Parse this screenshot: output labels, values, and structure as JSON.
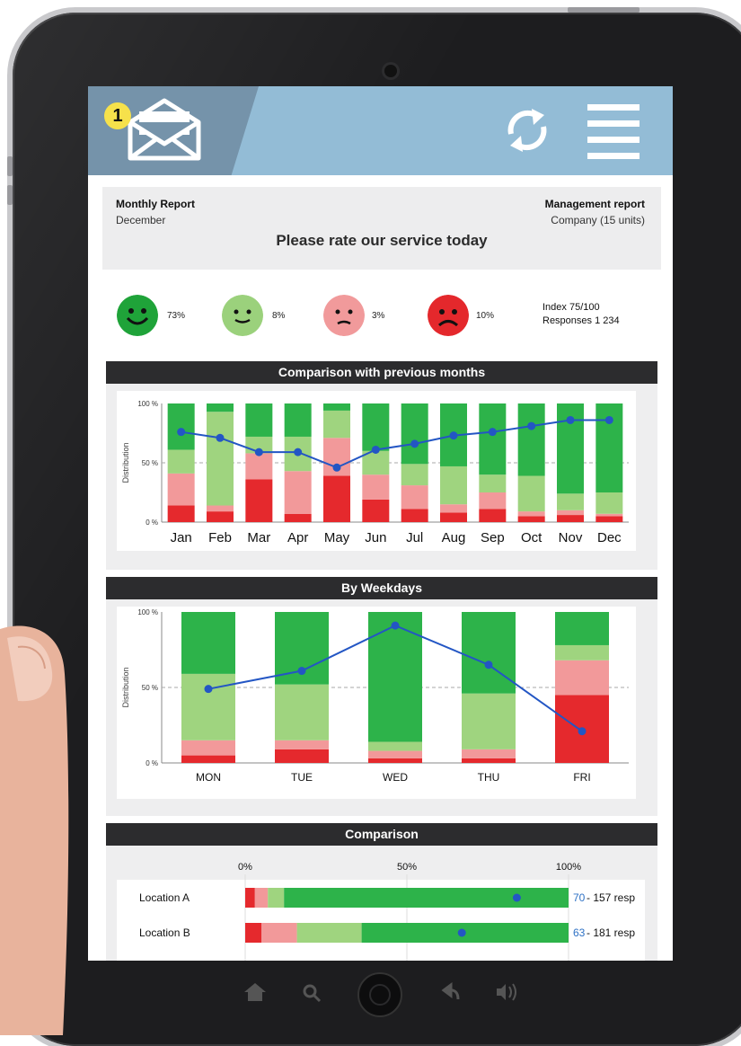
{
  "header": {
    "badge_count": "1",
    "icons": [
      "mail-icon",
      "sync-icon",
      "menu-icon"
    ]
  },
  "report": {
    "left_title": "Monthly Report",
    "left_sub": "December",
    "right_title": "Management report",
    "right_sub": "Company (15 units)",
    "prompt": "Please rate our service today"
  },
  "ratings": [
    {
      "name": "very-satisfied",
      "pct": "73%",
      "color": "#1fa339"
    },
    {
      "name": "satisfied",
      "pct": "8%",
      "color": "#9bd17c"
    },
    {
      "name": "dissatisfied",
      "pct": "3%",
      "color": "#f19a9b"
    },
    {
      "name": "very-dissatisfied",
      "pct": "10%",
      "color": "#e4282c"
    }
  ],
  "summary": {
    "index": "Index 75/100",
    "responses": "Responses 1 234"
  },
  "colors": {
    "dark_green": "#2db34a",
    "light_green": "#9fd47f",
    "pink": "#f2999a",
    "red": "#e5292d",
    "line": "#2356c4"
  },
  "chart_data": [
    {
      "type": "bar",
      "stacked": true,
      "title": "Comparison with previous months",
      "ylabel": "Distribution",
      "ylim": [
        0,
        100
      ],
      "yticks": [
        "0 %",
        "50 %",
        "100 %"
      ],
      "categories": [
        "Jan",
        "Feb",
        "Mar",
        "Apr",
        "May",
        "Jun",
        "Jul",
        "Aug",
        "Sep",
        "Oct",
        "Nov",
        "Dec"
      ],
      "series": [
        {
          "values": [
            14,
            9,
            36,
            7,
            39,
            19,
            11,
            8,
            11,
            5,
            6,
            5
          ]
        },
        {
          "values": [
            27,
            5,
            22,
            36,
            32,
            21,
            20,
            7,
            14,
            4,
            4,
            2
          ]
        },
        {
          "values": [
            20,
            79,
            14,
            29,
            23,
            20,
            18,
            32,
            15,
            30,
            14,
            18
          ]
        },
        {
          "values": [
            39,
            7,
            28,
            28,
            6,
            40,
            51,
            53,
            60,
            61,
            76,
            75
          ]
        }
      ],
      "line": [
        76,
        71,
        59,
        59,
        46,
        61,
        66,
        73,
        76,
        81,
        86,
        86
      ]
    },
    {
      "type": "bar",
      "stacked": true,
      "title": "By Weekdays",
      "ylabel": "Distribution",
      "ylim": [
        0,
        100
      ],
      "yticks": [
        "0 %",
        "50 %",
        "100 %"
      ],
      "categories": [
        "MON",
        "TUE",
        "WED",
        "THU",
        "FRI"
      ],
      "series": [
        {
          "values": [
            5,
            9,
            3,
            3,
            45
          ]
        },
        {
          "values": [
            10,
            6,
            5,
            6,
            23
          ]
        },
        {
          "values": [
            44,
            37,
            6,
            37,
            10
          ]
        },
        {
          "values": [
            41,
            48,
            86,
            54,
            22
          ]
        }
      ],
      "line": [
        49,
        61,
        91,
        65,
        21
      ]
    },
    {
      "type": "bar",
      "stacked": true,
      "orientation": "horizontal",
      "title": "Comparison",
      "xticks": [
        "0%",
        "50%",
        "100%"
      ],
      "categories": [
        "Location A",
        "Location B"
      ],
      "series": [
        {
          "values": [
            3,
            5
          ]
        },
        {
          "values": [
            4,
            11
          ]
        },
        {
          "values": [
            5,
            20
          ]
        },
        {
          "values": [
            88,
            64
          ]
        }
      ],
      "index": [
        84,
        67
      ],
      "labels": [
        {
          "score": "70",
          "resp": " - 157 resp"
        },
        {
          "score": "63",
          "resp": " - 181 resp"
        }
      ]
    }
  ]
}
